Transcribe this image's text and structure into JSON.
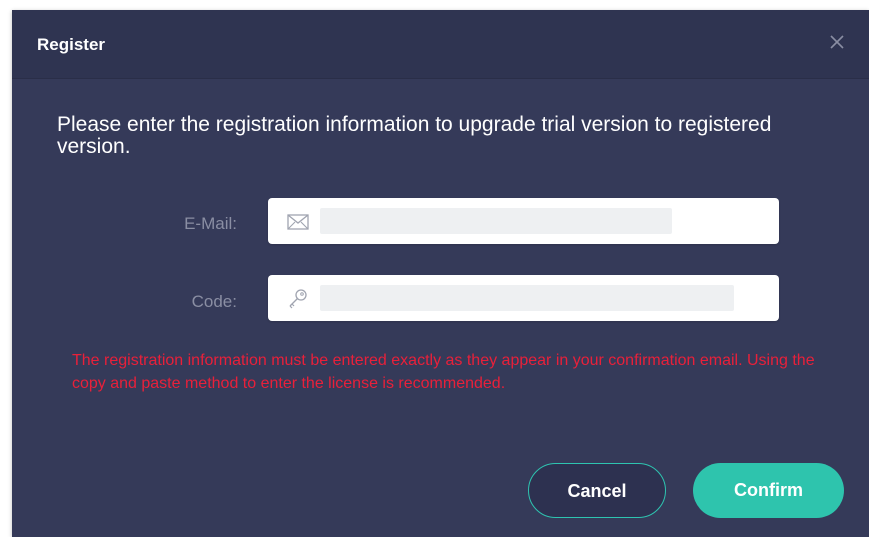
{
  "dialog": {
    "title": "Register",
    "instructions": "Please enter the registration information to upgrade trial version to registered version.",
    "fields": {
      "email": {
        "label": "E-Mail:",
        "value": "",
        "icon": "envelope-icon"
      },
      "code": {
        "label": "Code:",
        "value": "",
        "icon": "key-icon"
      }
    },
    "warning": "The registration information must be entered exactly as they appear in your confirmation email. Using the copy and paste method to enter the license is recommended.",
    "buttons": {
      "cancel": "Cancel",
      "confirm": "Confirm"
    }
  },
  "colors": {
    "dialog_bg": "#353a59",
    "accent": "#2ec4ad",
    "warning": "#e8203a",
    "label": "#8a8ea3"
  }
}
